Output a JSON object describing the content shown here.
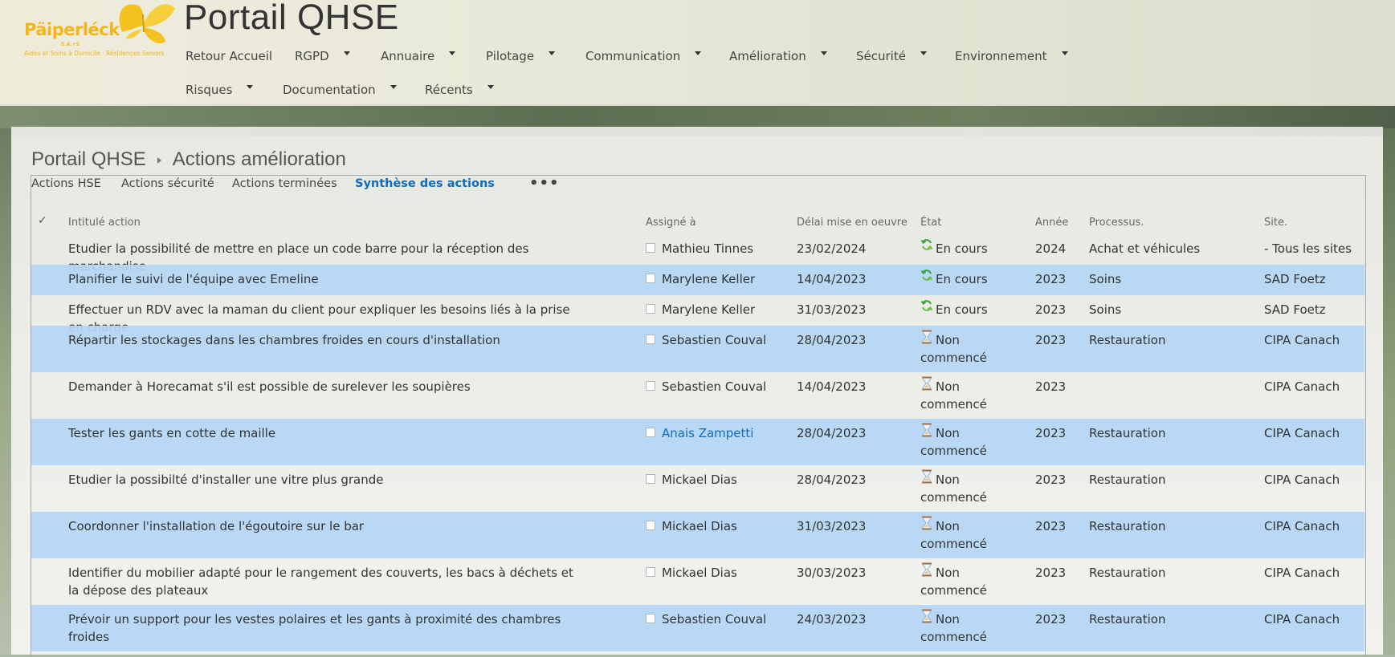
{
  "brand": {
    "name": "Päiperléck",
    "legal": "S.A.+S",
    "tagline": "Aides et Soins à Domicile · Résidences Seniors",
    "color": "#f2b61b"
  },
  "site_title": "Portail QHSE",
  "nav": [
    {
      "label": "Retour Accueil",
      "has_menu": false
    },
    {
      "label": "RGPD",
      "has_menu": true
    },
    {
      "label": "Annuaire",
      "has_menu": true
    },
    {
      "label": "Pilotage",
      "has_menu": true
    },
    {
      "label": "Communication",
      "has_menu": true
    },
    {
      "label": "Amélioration",
      "has_menu": true
    },
    {
      "label": "Sécurité",
      "has_menu": true
    },
    {
      "label": "Environnement",
      "has_menu": true
    },
    {
      "label": "Risques",
      "has_menu": true
    },
    {
      "label": "Documentation",
      "has_menu": true
    },
    {
      "label": "Récents",
      "has_menu": true
    }
  ],
  "breadcrumb": {
    "root": "Portail QHSE",
    "current": "Actions amélioration"
  },
  "views": [
    {
      "label": "Actions HSE",
      "active": false
    },
    {
      "label": "Actions sécurité",
      "active": false
    },
    {
      "label": "Actions terminées",
      "active": false
    },
    {
      "label": "Synthèse des actions",
      "active": true
    }
  ],
  "more_views": "•••",
  "columns": {
    "select": "✓",
    "title": "Intitulé action",
    "assigned": "Assigné à",
    "deadline": "Délai mise en oeuvre",
    "state": "État",
    "year": "Année",
    "process": "Processus.",
    "site": "Site."
  },
  "state_icons": {
    "En cours": "refresh-icon",
    "Non commencé": "hourglass-icon"
  },
  "rows": [
    {
      "title": "Etudier la possibilité de mettre en place un code barre pour la réception des marchandise",
      "assigned": "Mathieu Tinnes",
      "deadline": "23/02/2024",
      "state": "En cours",
      "year": "2024",
      "process": "Achat et véhicules",
      "site": "- Tous les sites"
    },
    {
      "title": "Planifier le suivi de l'équipe avec Emeline",
      "assigned": "Marylene Keller",
      "deadline": "14/04/2023",
      "state": "En cours",
      "year": "2023",
      "process": "Soins",
      "site": "SAD Foetz"
    },
    {
      "title": "Effectuer un RDV avec la maman du client pour expliquer les besoins liés à la prise en charge",
      "assigned": "Marylene Keller",
      "deadline": "31/03/2023",
      "state": "En cours",
      "year": "2023",
      "process": "Soins",
      "site": "SAD Foetz"
    },
    {
      "title": "Répartir les stockages dans les chambres froides en cours d'installation",
      "assigned": "Sebastien Couval",
      "deadline": "28/04/2023",
      "state": "Non commencé",
      "year": "2023",
      "process": "Restauration",
      "site": "CIPA Canach"
    },
    {
      "title": "Demander à Horecamat s'il est possible de surelever les soupières",
      "assigned": "Sebastien Couval",
      "deadline": "14/04/2023",
      "state": "Non commencé",
      "year": "2023",
      "process": "",
      "site": "CIPA Canach"
    },
    {
      "title": "Tester les gants en cotte de maille",
      "assigned": "Anais Zampetti",
      "deadline": "28/04/2023",
      "state": "Non commencé",
      "year": "2023",
      "process": "Restauration",
      "site": "CIPA Canach"
    },
    {
      "title": "Etudier la possibilté d'installer une vitre plus grande",
      "assigned": "Mickael Dias",
      "deadline": "28/04/2023",
      "state": "Non commencé",
      "year": "2023",
      "process": "Restauration",
      "site": "CIPA Canach"
    },
    {
      "title": "Coordonner l'installation de l'égoutoire sur le bar",
      "assigned": "Mickael Dias",
      "deadline": "31/03/2023",
      "state": "Non commencé",
      "year": "2023",
      "process": "Restauration",
      "site": "CIPA Canach"
    },
    {
      "title": "Identifier du mobilier adapté pour le rangement des couverts, les bacs à déchets et la dépose des plateaux",
      "assigned": "Mickael Dias",
      "deadline": "30/03/2023",
      "state": "Non commencé",
      "year": "2023",
      "process": "Restauration",
      "site": "CIPA Canach"
    },
    {
      "title": "Prévoir un support pour les vestes polaires et les gants à proximité des chambres froides",
      "assigned": "Sebastien Couval",
      "deadline": "24/03/2023",
      "state": "Non commencé",
      "year": "2023",
      "process": "Restauration",
      "site": "CIPA Canach"
    }
  ]
}
